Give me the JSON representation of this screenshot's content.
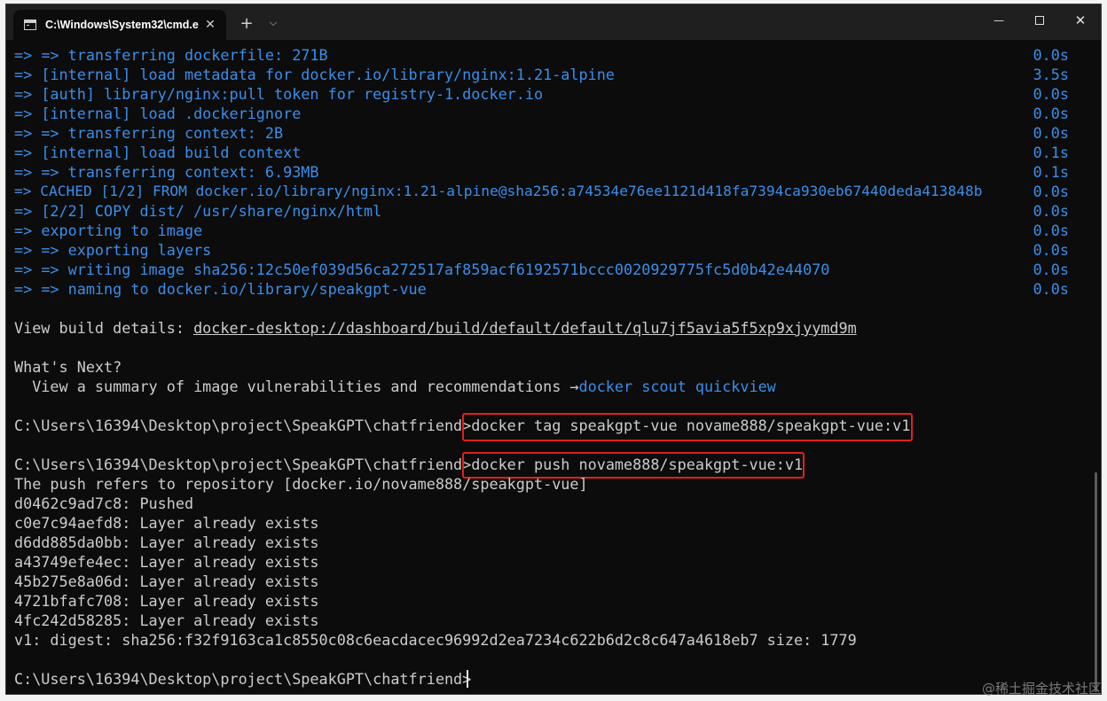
{
  "window": {
    "tab_title": "C:\\Windows\\System32\\cmd.e",
    "tab_close": "✕",
    "new_tab": "+",
    "dropdown": "⌵",
    "minimize": "—",
    "close": "✕"
  },
  "build_steps": [
    {
      "arrow": "=> ",
      "text": "=> transferring dockerfile: 271B",
      "time": "0.0s"
    },
    {
      "arrow": "=> ",
      "text": "[internal] load metadata for docker.io/library/nginx:1.21-alpine",
      "time": "3.5s"
    },
    {
      "arrow": "=> ",
      "text": "[auth] library/nginx:pull token for registry-1.docker.io",
      "time": "0.0s"
    },
    {
      "arrow": "=> ",
      "text": "[internal] load .dockerignore",
      "time": "0.0s"
    },
    {
      "arrow": "=> ",
      "text": "=> transferring context: 2B",
      "time": "0.0s"
    },
    {
      "arrow": "=> ",
      "text": "[internal] load build context",
      "time": "0.1s"
    },
    {
      "arrow": "=> ",
      "text": "=> transferring context: 6.93MB",
      "time": "0.1s"
    },
    {
      "arrow": "=> ",
      "text": "CACHED [1/2] FROM docker.io/library/nginx:1.21-alpine@sha256:a74534e76ee1121d418fa7394ca930eb67440deda413848b",
      "time": "0.0s"
    },
    {
      "arrow": "=> ",
      "text": "[2/2] COPY dist/ /usr/share/nginx/html",
      "time": "0.0s"
    },
    {
      "arrow": "=> ",
      "text": "exporting to image",
      "time": "0.0s"
    },
    {
      "arrow": "=> ",
      "text": "=> exporting layers",
      "time": "0.0s"
    },
    {
      "arrow": "=> ",
      "text": "=> writing image sha256:12c50ef039d56ca272517af859acf6192571bccc0020929775fc5d0b42e44070",
      "time": "0.0s"
    },
    {
      "arrow": "=> ",
      "text": "=> naming to docker.io/library/speakgpt-vue",
      "time": "0.0s"
    }
  ],
  "build_details": {
    "label": "View build details: ",
    "link": "docker-desktop://dashboard/build/default/default/qlu7jf5avia5f5xp9xjyymd9m"
  },
  "whats_next": {
    "heading": "What's Next?",
    "text": "  View a summary of image vulnerabilities and recommendations →",
    "command": "docker scout quickview"
  },
  "prompt": "C:\\Users\\16394\\Desktop\\project\\SpeakGPT\\chatfriend>",
  "commands": {
    "tag": "docker tag speakgpt-vue novame888/speakgpt-vue:v1",
    "push": "docker push novame888/speakgpt-vue:v1"
  },
  "push_output": [
    "The push refers to repository [docker.io/novame888/speakgpt-vue]",
    "d0462c9ad7c8: Pushed",
    "c0e7c94aefd8: Layer already exists",
    "d6dd885da0bb: Layer already exists",
    "a43749efe4ec: Layer already exists",
    "45b275e8a06d: Layer already exists",
    "4721bfafc708: Layer already exists",
    "4fc242d58285: Layer already exists",
    "v1: digest: sha256:f32f9163ca1c8550c08c6eacdacec96992d2ea7234c622b6d2c8c647a4618eb7 size: 1779"
  ],
  "watermark": "@稀土掘金技术社区",
  "colors": {
    "terminal_bg": "#0c0c0c",
    "blue": "#3b8eea",
    "grey": "#cccccc",
    "highlight": "#e02020"
  }
}
